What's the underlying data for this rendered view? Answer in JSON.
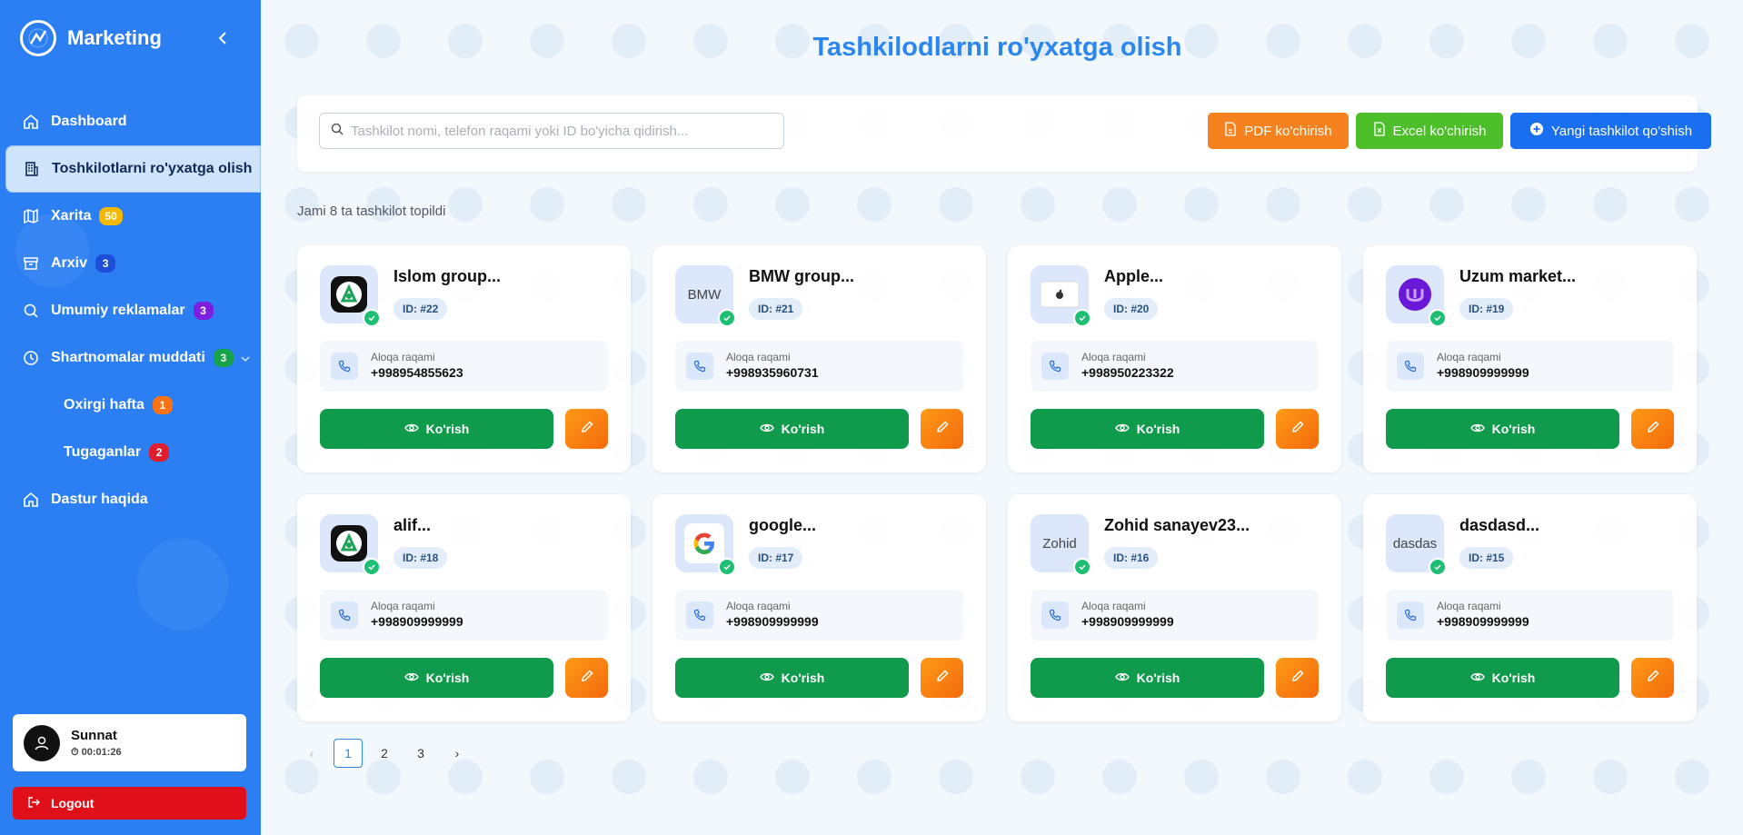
{
  "app": {
    "title": "Marketing"
  },
  "sidebar": {
    "items": [
      {
        "label": "Dashboard",
        "icon": "home-icon"
      },
      {
        "label": "Toshkilotlarni ro'yxatga olish",
        "icon": "building-icon"
      },
      {
        "label": "Xarita",
        "icon": "map-icon",
        "badge": "50",
        "badge_color": "#f5b800"
      },
      {
        "label": "Arxiv",
        "icon": "archive-icon",
        "badge": "3",
        "badge_color": "#1d4ed8"
      },
      {
        "label": "Umumiy reklamalar",
        "icon": "search-icon",
        "badge": "3",
        "badge_color": "#7c1fe0"
      },
      {
        "label": "Shartnomalar muddati",
        "icon": "clock-icon",
        "badge": "3",
        "badge_color": "#16a34a"
      },
      {
        "label": "Oxirgi hafta",
        "badge": "1",
        "badge_color": "#f97316"
      },
      {
        "label": "Tugaganlar",
        "badge": "2",
        "badge_color": "#e11d2e"
      },
      {
        "label": "Dastur haqida",
        "icon": "home-icon"
      }
    ]
  },
  "user": {
    "name": "Sunnat",
    "time": "00:01:26"
  },
  "logout_label": "Logout",
  "page": {
    "title": "Tashkilodlarni ro'yxatga olish"
  },
  "search": {
    "placeholder": "Tashkilot nomi, telefon raqami yoki ID bo'yicha qidirish..."
  },
  "toolbar": {
    "pdf_label": "PDF ko'chirish",
    "excel_label": "Excel ko'chirish",
    "add_label": "Yangi tashkilot qo'shish"
  },
  "found_text": "Jami 8 ta tashkilot topildi",
  "card_labels": {
    "contact_label": "Aloqa raqami",
    "view_label": "Ko'rish"
  },
  "cards": [
    {
      "name": "Islom group...",
      "id": "ID: #22",
      "phone": "+998954855623",
      "logo": "alif-logo"
    },
    {
      "name": "BMW group...",
      "id": "ID: #21",
      "phone": "+998935960731",
      "logo": "broken-image",
      "alt": "BMW"
    },
    {
      "name": "Apple...",
      "id": "ID: #20",
      "phone": "+998950223322",
      "logo": "apple-logo"
    },
    {
      "name": "Uzum market...",
      "id": "ID: #19",
      "phone": "+998909999999",
      "logo": "uzum-logo"
    },
    {
      "name": "alif...",
      "id": "ID: #18",
      "phone": "+998909999999",
      "logo": "alif-logo"
    },
    {
      "name": "google...",
      "id": "ID: #17",
      "phone": "+998909999999",
      "logo": "google-logo"
    },
    {
      "name": "Zohid sanayev23...",
      "id": "ID: #16",
      "phone": "+998909999999",
      "logo": "broken-image",
      "alt": "Zohid"
    },
    {
      "name": "dasdasd...",
      "id": "ID: #15",
      "phone": "+998909999999",
      "logo": "broken-image",
      "alt": "dasdas"
    }
  ],
  "pagination": {
    "pages": [
      "1",
      "2",
      "3"
    ],
    "current": "1",
    "prev": "‹",
    "next": "›"
  },
  "colors": {
    "sidebar": "#2b7ff2",
    "accent": "#2b86ee",
    "view": "#0f9a4c",
    "pdf": "#f5821f",
    "excel": "#4cbf2b",
    "add": "#1a6ff0"
  }
}
